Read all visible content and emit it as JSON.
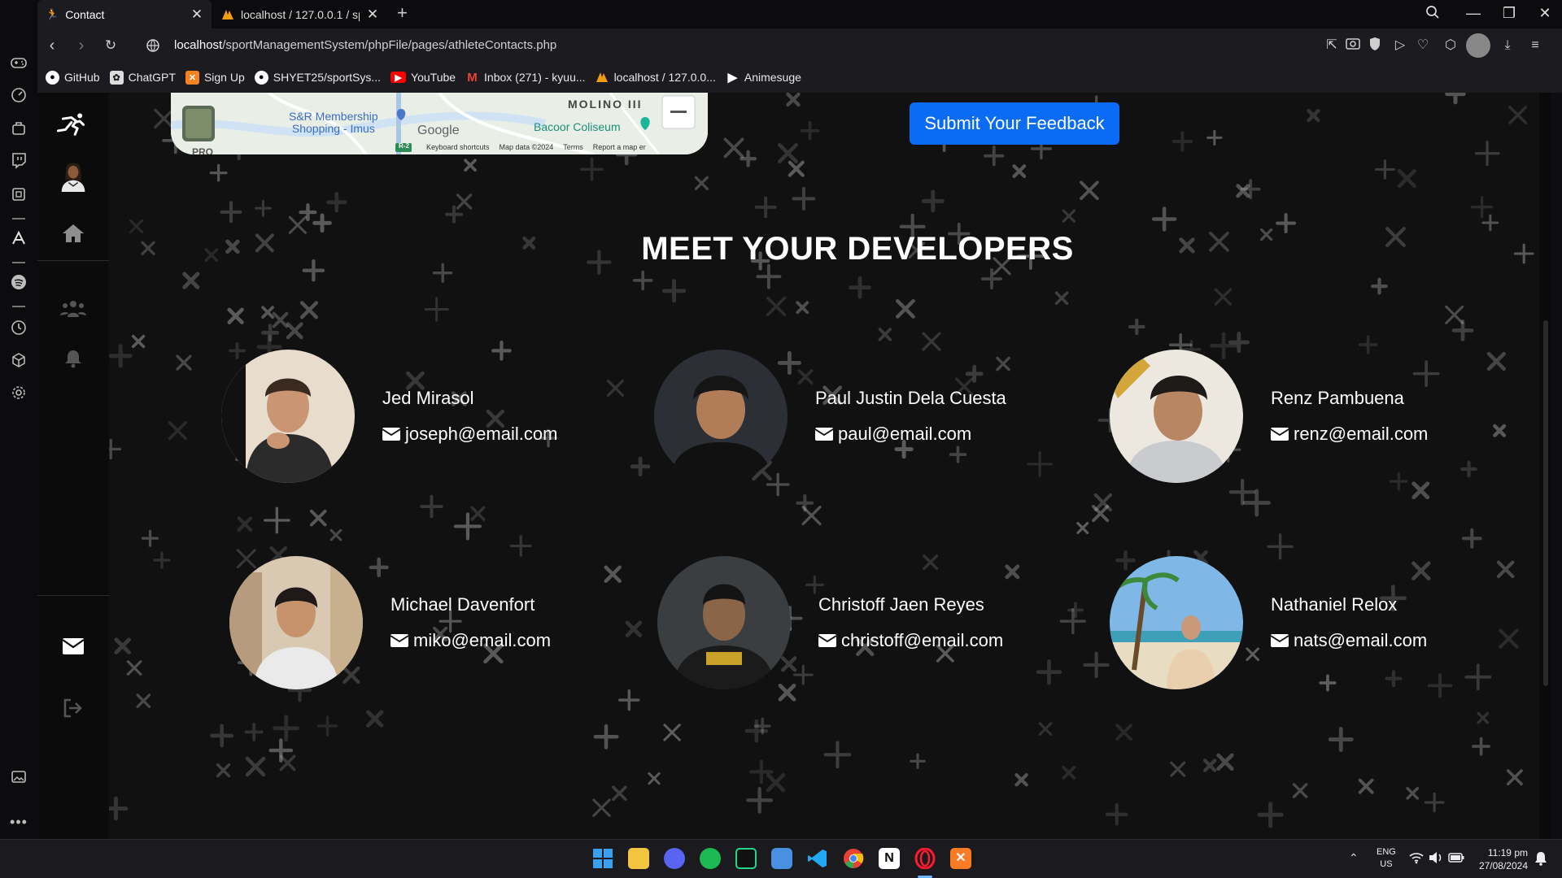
{
  "browser": {
    "tabs": [
      {
        "title": "Contact"
      },
      {
        "title": "localhost / 127.0.0.1 / sp"
      }
    ],
    "url": {
      "host": "localhost",
      "path": "/sportManagementSystem/phpFile/pages/athleteContacts.php"
    },
    "bookmarks": [
      {
        "label": "GitHub",
        "icon": "github-icon"
      },
      {
        "label": "ChatGPT",
        "icon": "chatgpt-icon"
      },
      {
        "label": "Sign Up",
        "icon": "xampp-icon"
      },
      {
        "label": "SHYET25/sportSys...",
        "icon": "github-icon"
      },
      {
        "label": "YouTube",
        "icon": "youtube-icon"
      },
      {
        "label": "Inbox (271) - kyuu...",
        "icon": "gmail-icon"
      },
      {
        "label": "localhost / 127.0.0...",
        "icon": "phpmyadmin-icon"
      },
      {
        "label": "Animesuge",
        "icon": "play-icon"
      }
    ]
  },
  "map": {
    "labels": {
      "place1": "S&R Membership",
      "place1b": "Shopping - Imus",
      "place2": "MOLINO III",
      "place3": "Bacoor Coliseum",
      "route": "R-2",
      "brand": "Google",
      "corner": "PRO"
    },
    "footer": [
      "Keyboard shortcuts",
      "Map data ©2024",
      "Terms",
      "Report a map er"
    ]
  },
  "feedback_button": "Submit Your Feedback",
  "section_title": "MEET YOUR DEVELOPERS",
  "developers": [
    {
      "name": "Jed Mirasol",
      "email": "joseph@email.com"
    },
    {
      "name": "Paul Justin Dela Cuesta",
      "email": "paul@email.com"
    },
    {
      "name": "Renz Pambuena",
      "email": "renz@email.com"
    },
    {
      "name": "Michael Davenfort",
      "email": "miko@email.com"
    },
    {
      "name": "Christoff Jaen Reyes",
      "email": "christoff@email.com"
    },
    {
      "name": "Nathaniel Relox",
      "email": "nats@email.com"
    }
  ],
  "taskbar": {
    "lang": "ENG",
    "region": "US",
    "time": "11:19 pm",
    "date": "27/08/2024"
  },
  "colors": {
    "accent": "#0a6cf5",
    "page_bg": "#111111"
  }
}
